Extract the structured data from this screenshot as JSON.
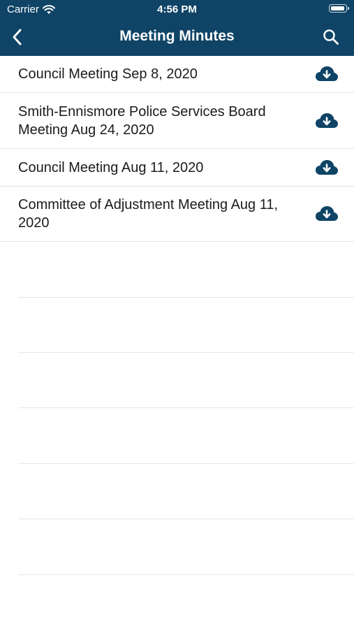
{
  "status_bar": {
    "carrier": "Carrier",
    "time": "4:56 PM"
  },
  "nav": {
    "title": "Meeting Minutes",
    "back_icon": "chevron-left-icon",
    "search_icon": "search-icon"
  },
  "colors": {
    "header_bg": "#0f4466",
    "icon": "#0f4466"
  },
  "list": {
    "items": [
      {
        "title": "Council Meeting Sep 8, 2020",
        "icon": "cloud-download-icon"
      },
      {
        "title": "Smith-Ennismore Police Services Board Meeting Aug 24, 2020",
        "icon": "cloud-download-icon"
      },
      {
        "title": "Council Meeting Aug 11, 2020",
        "icon": "cloud-download-icon"
      },
      {
        "title": "Committee of Adjustment Meeting Aug 11, 2020",
        "icon": "cloud-download-icon"
      }
    ]
  }
}
